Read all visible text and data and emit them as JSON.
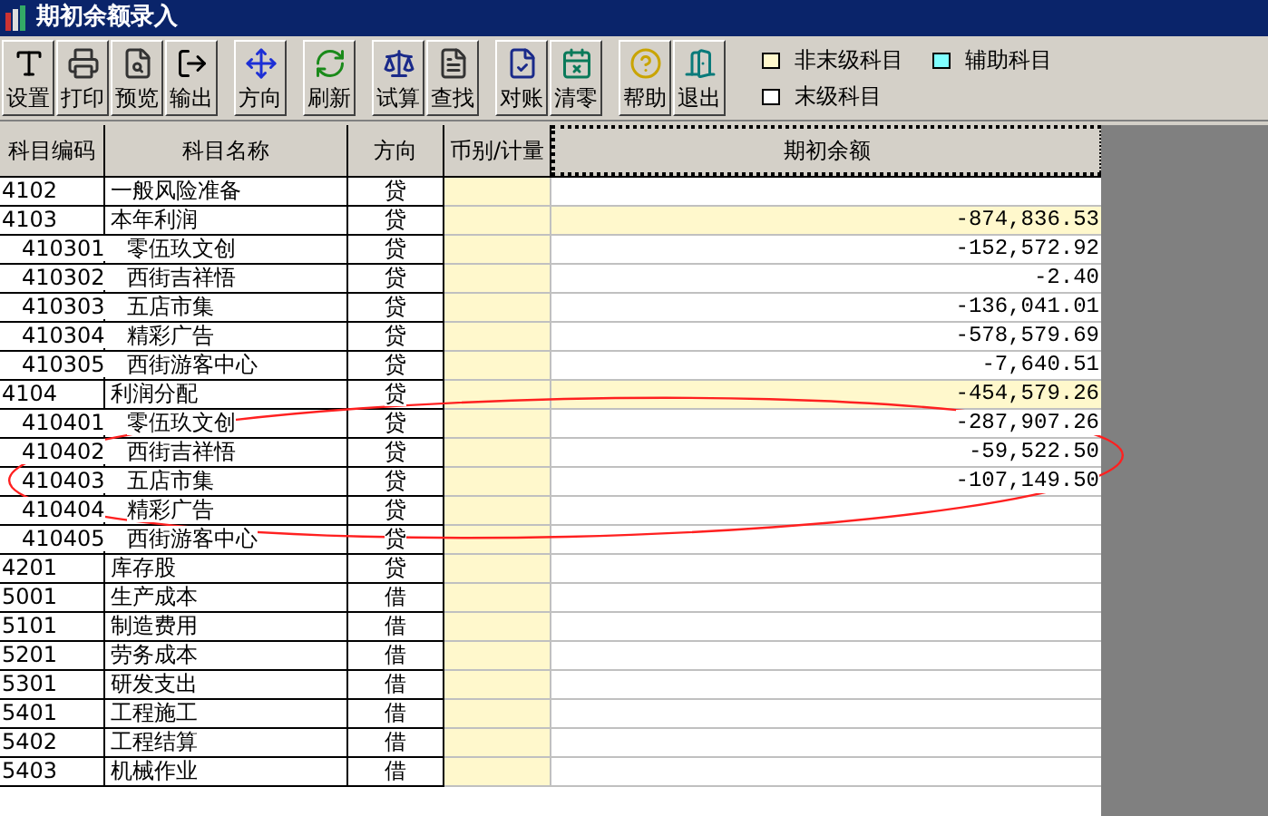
{
  "window": {
    "title": "期初余额录入"
  },
  "toolbar": [
    {
      "label": "设置"
    },
    {
      "label": "打印"
    },
    {
      "label": "预览"
    },
    {
      "label": "输出"
    },
    {
      "label": "方向"
    },
    {
      "label": "刷新"
    },
    {
      "label": "试算"
    },
    {
      "label": "查找"
    },
    {
      "label": "对账"
    },
    {
      "label": "清零"
    },
    {
      "label": "帮助"
    },
    {
      "label": "退出"
    }
  ],
  "legend": [
    {
      "label": "非末级科目",
      "color": "#fff8cc"
    },
    {
      "label": "辅助科目",
      "color": "#80ffff"
    },
    {
      "label": "末级科目",
      "color": "#ffffff"
    }
  ],
  "table": {
    "columns": [
      "科目编码",
      "科目名称",
      "方向",
      "币别/计量",
      "期初余额"
    ],
    "rows": [
      {
        "code": "4102",
        "name": "一般风险准备",
        "direction": "贷"
      },
      {
        "code": "4103",
        "name": "本年利润",
        "direction": "贷",
        "balance": "-874,836.53",
        "children": [
          {
            "code": "410301",
            "name": "零伍玖文创",
            "direction": "贷",
            "balance": "-152,572.92"
          },
          {
            "code": "410302",
            "name": "西街吉祥悟",
            "direction": "贷",
            "balance": "-2.40"
          },
          {
            "code": "410303",
            "name": "五店市集",
            "direction": "贷",
            "balance": "-136,041.01"
          },
          {
            "code": "410304",
            "name": "精彩广告",
            "direction": "贷",
            "balance": "-578,579.69"
          },
          {
            "code": "410305",
            "name": "西街游客中心",
            "direction": "贷",
            "balance": "-7,640.51"
          }
        ]
      },
      {
        "code": "4104",
        "name": "利润分配",
        "direction": "贷",
        "balance": "-454,579.26",
        "children": [
          {
            "code": "410401",
            "name": "零伍玖文创",
            "direction": "贷",
            "balance": "-287,907.26"
          },
          {
            "code": "410402",
            "name": "西街吉祥悟",
            "direction": "贷",
            "balance": "-59,522.50"
          },
          {
            "code": "410403",
            "name": "五店市集",
            "direction": "贷",
            "balance": "-107,149.50"
          },
          {
            "code": "410404",
            "name": "精彩广告",
            "direction": "贷"
          },
          {
            "code": "410405",
            "name": "西街游客中心",
            "direction": "贷"
          }
        ]
      },
      {
        "code": "4201",
        "name": "库存股",
        "direction": "贷"
      },
      {
        "code": "5001",
        "name": "生产成本",
        "direction": "借"
      },
      {
        "code": "5101",
        "name": "制造费用",
        "direction": "借"
      },
      {
        "code": "5201",
        "name": "劳务成本",
        "direction": "借"
      },
      {
        "code": "5301",
        "name": "研发支出",
        "direction": "借"
      },
      {
        "code": "5401",
        "name": "工程施工",
        "direction": "借"
      },
      {
        "code": "5402",
        "name": "工程结算",
        "direction": "借"
      },
      {
        "code": "5403",
        "name": "机械作业",
        "direction": "借"
      }
    ]
  }
}
